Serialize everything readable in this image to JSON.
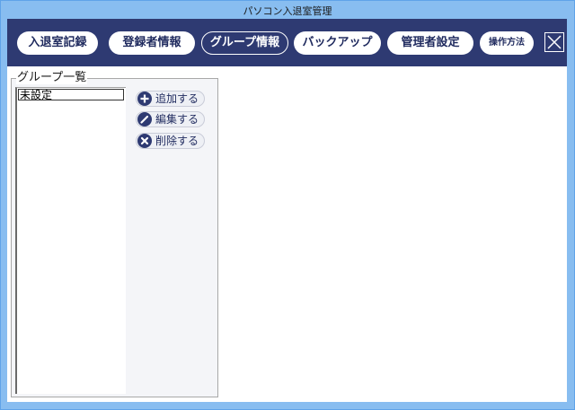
{
  "window": {
    "title": "パソコン入退室管理"
  },
  "nav": {
    "tabs": [
      {
        "label": "入退室記録",
        "active": false
      },
      {
        "label": "登録者情報",
        "active": false
      },
      {
        "label": "グループ情報",
        "active": true
      },
      {
        "label": "バックアップ",
        "active": false
      },
      {
        "label": "管理者設定",
        "active": false
      },
      {
        "label": "操作方法",
        "active": false
      }
    ],
    "close_icon": "close-icon"
  },
  "group_panel": {
    "legend": "グループ一覧",
    "items": [
      "未設定"
    ],
    "actions": {
      "add": {
        "label": "追加する",
        "icon": "plus-circle-icon"
      },
      "edit": {
        "label": "編集する",
        "icon": "pencil-circle-icon"
      },
      "delete": {
        "label": "削除する",
        "icon": "x-circle-icon"
      }
    }
  },
  "colors": {
    "titlebar": "#88bdf0",
    "navbar": "#2e3a72",
    "accent_text": "#1f2a5e"
  }
}
